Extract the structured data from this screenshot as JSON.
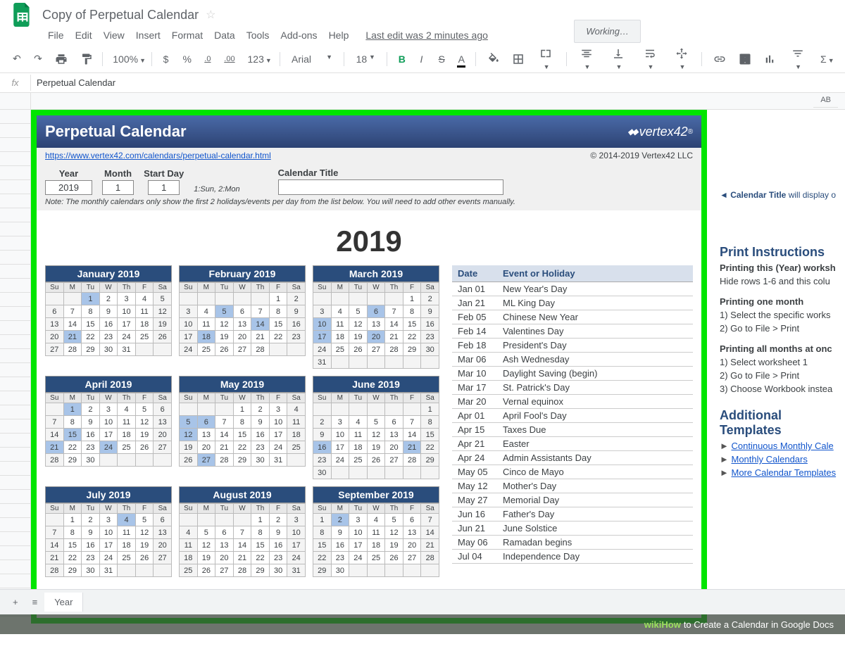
{
  "doc": {
    "title": "Copy of Perpetual Calendar",
    "last_edit": "Last edit was 2 minutes ago",
    "working": "Working…"
  },
  "menu": [
    "File",
    "Edit",
    "View",
    "Insert",
    "Format",
    "Data",
    "Tools",
    "Add-ons",
    "Help"
  ],
  "toolbar": {
    "zoom": "100%",
    "decimal_fmt": ".0",
    "decimal_fmt2": ".00",
    "num_fmt": "123",
    "font": "Arial",
    "size": "18"
  },
  "formula": {
    "value": "Perpetual Calendar"
  },
  "calendar": {
    "title": "Perpetual Calendar",
    "brand": "vertex42",
    "url": "https://www.vertex42.com/calendars/perpetual-calendar.html",
    "copyright": "© 2014-2019 Vertex42 LLC",
    "inputs": {
      "year_label": "Year",
      "year": "2019",
      "month_label": "Month",
      "month": "1",
      "startday_label": "Start Day",
      "startday": "1",
      "startday_hint": "1:Sun, 2:Mon",
      "caltitle_label": "Calendar Title"
    },
    "note": "Note: The monthly calendars only show the first 2 holidays/events per day from the list below. You will need to add other events manually.",
    "big_year": "2019",
    "dow": [
      "Su",
      "M",
      "Tu",
      "W",
      "Th",
      "F",
      "Sa"
    ],
    "months": [
      {
        "name": "January 2019",
        "lead": 2,
        "days": 31,
        "hl": [
          1,
          21
        ]
      },
      {
        "name": "February 2019",
        "lead": 5,
        "days": 28,
        "hl": [
          5,
          14,
          18
        ]
      },
      {
        "name": "March 2019",
        "lead": 5,
        "days": 31,
        "hl": [
          6,
          10,
          17,
          20
        ]
      },
      {
        "name": "April 2019",
        "lead": 1,
        "days": 30,
        "hl": [
          1,
          15,
          21,
          24
        ]
      },
      {
        "name": "May 2019",
        "lead": 3,
        "days": 31,
        "hl": [
          5,
          6,
          12,
          27
        ]
      },
      {
        "name": "June 2019",
        "lead": 6,
        "days": 30,
        "hl": [
          16,
          21
        ]
      },
      {
        "name": "July 2019",
        "lead": 1,
        "days": 31,
        "hl": [
          4
        ]
      },
      {
        "name": "August 2019",
        "lead": 4,
        "days": 31,
        "hl": []
      },
      {
        "name": "September 2019",
        "lead": 0,
        "days": 30,
        "hl": [
          2
        ]
      }
    ],
    "events_header": {
      "date": "Date",
      "event": "Event or Holiday"
    },
    "events": [
      {
        "d": "Jan 01",
        "e": "New Year's Day"
      },
      {
        "d": "Jan 21",
        "e": "ML King Day"
      },
      {
        "d": "Feb 05",
        "e": "Chinese New Year"
      },
      {
        "d": "Feb 14",
        "e": "Valentines Day"
      },
      {
        "d": "Feb 18",
        "e": "President's Day"
      },
      {
        "d": "Mar 06",
        "e": "Ash Wednesday"
      },
      {
        "d": "Mar 10",
        "e": "Daylight Saving (begin)"
      },
      {
        "d": "Mar 17",
        "e": "St. Patrick's Day"
      },
      {
        "d": "Mar 20",
        "e": "Vernal equinox"
      },
      {
        "d": "Apr 01",
        "e": "April Fool's Day"
      },
      {
        "d": "Apr 15",
        "e": "Taxes Due"
      },
      {
        "d": "Apr 21",
        "e": "Easter"
      },
      {
        "d": "Apr 24",
        "e": "Admin Assistants Day"
      },
      {
        "d": "May 05",
        "e": "Cinco de Mayo"
      },
      {
        "d": "May 12",
        "e": "Mother's Day"
      },
      {
        "d": "May 27",
        "e": "Memorial Day"
      },
      {
        "d": "Jun 16",
        "e": "Father's Day"
      },
      {
        "d": "Jun 21",
        "e": "June Solstice"
      },
      {
        "d": "May 06",
        "e": "Ramadan begins"
      },
      {
        "d": "Jul 04",
        "e": "Independence Day"
      }
    ]
  },
  "right": {
    "ct_hint_prefix": "◄ ",
    "ct_hint_bold": "Calendar Title",
    "ct_hint_rest": " will display o",
    "h1": "Print Instructions",
    "sub1": "Printing this (Year) worksh",
    "p1": "Hide rows 1-6 and this colu",
    "sub2": "Printing one month",
    "s2a": "1) Select the specific works",
    "s2b": "2) Go to File > Print",
    "sub3": "Printing all months at onc",
    "s3a": "1) Select worksheet 1",
    "s3b": "2) Go to File > Print",
    "s3c": "3) Choose Workbook instea",
    "h2": "Additional Templates",
    "l1": "Continuous Monthly Cale",
    "l2": "Monthly Calendars",
    "l3": "More Calendar Templates"
  },
  "col_far": "AB",
  "sheet_tabs": {
    "active": "Year"
  },
  "wiki": {
    "brand": "wikiHow",
    "title": " to Create a Calendar in Google Docs"
  }
}
